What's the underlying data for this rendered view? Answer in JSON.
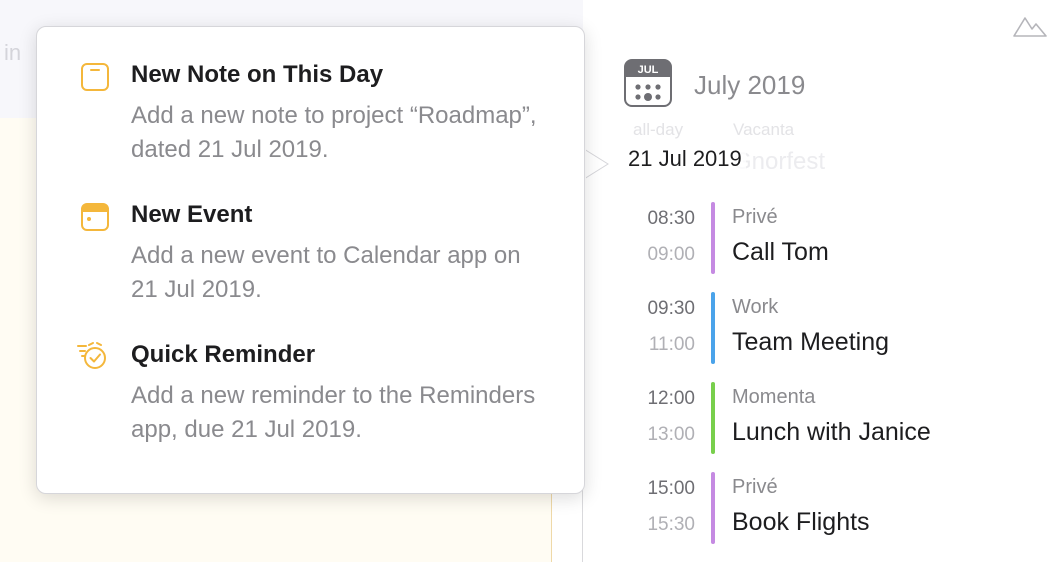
{
  "background": {
    "editor_fragment": "in"
  },
  "calendar_panel": {
    "calendar_icon_label": "JUL",
    "month_title": "July 2019",
    "ghost_allday": "all-day",
    "ghost_calendar": "Vacanta",
    "ghost_title": "Gnorfest",
    "selected_date": "21 Jul 2019",
    "events": [
      {
        "start": "08:30",
        "end": "09:00",
        "calendar": "Privé",
        "title": "Call Tom",
        "color": "#c58ae2"
      },
      {
        "start": "09:30",
        "end": "11:00",
        "calendar": "Work",
        "title": "Team Meeting",
        "color": "#4aa3ea"
      },
      {
        "start": "12:00",
        "end": "13:00",
        "calendar": "Momenta",
        "title": "Lunch with Janice",
        "color": "#78cf4c"
      },
      {
        "start": "15:00",
        "end": "15:30",
        "calendar": "Privé",
        "title": "Book Flights",
        "color": "#c58ae2"
      }
    ]
  },
  "popover": {
    "items": [
      {
        "title": "New Note on This Day",
        "description": "Add a new note to project “Roadmap”, dated 21 Jul 2019.",
        "icon": "note-icon"
      },
      {
        "title": "New Event",
        "description": "Add a new event to Calendar app on 21 Jul 2019.",
        "icon": "calendar-event-icon"
      },
      {
        "title": "Quick Reminder",
        "description": "Add a new reminder to the Reminders app, due 21 Jul 2019.",
        "icon": "reminder-alarm-icon"
      }
    ]
  },
  "colors": {
    "accent_icon": "#f4b73b",
    "editor_bg": "#fffcf3"
  }
}
